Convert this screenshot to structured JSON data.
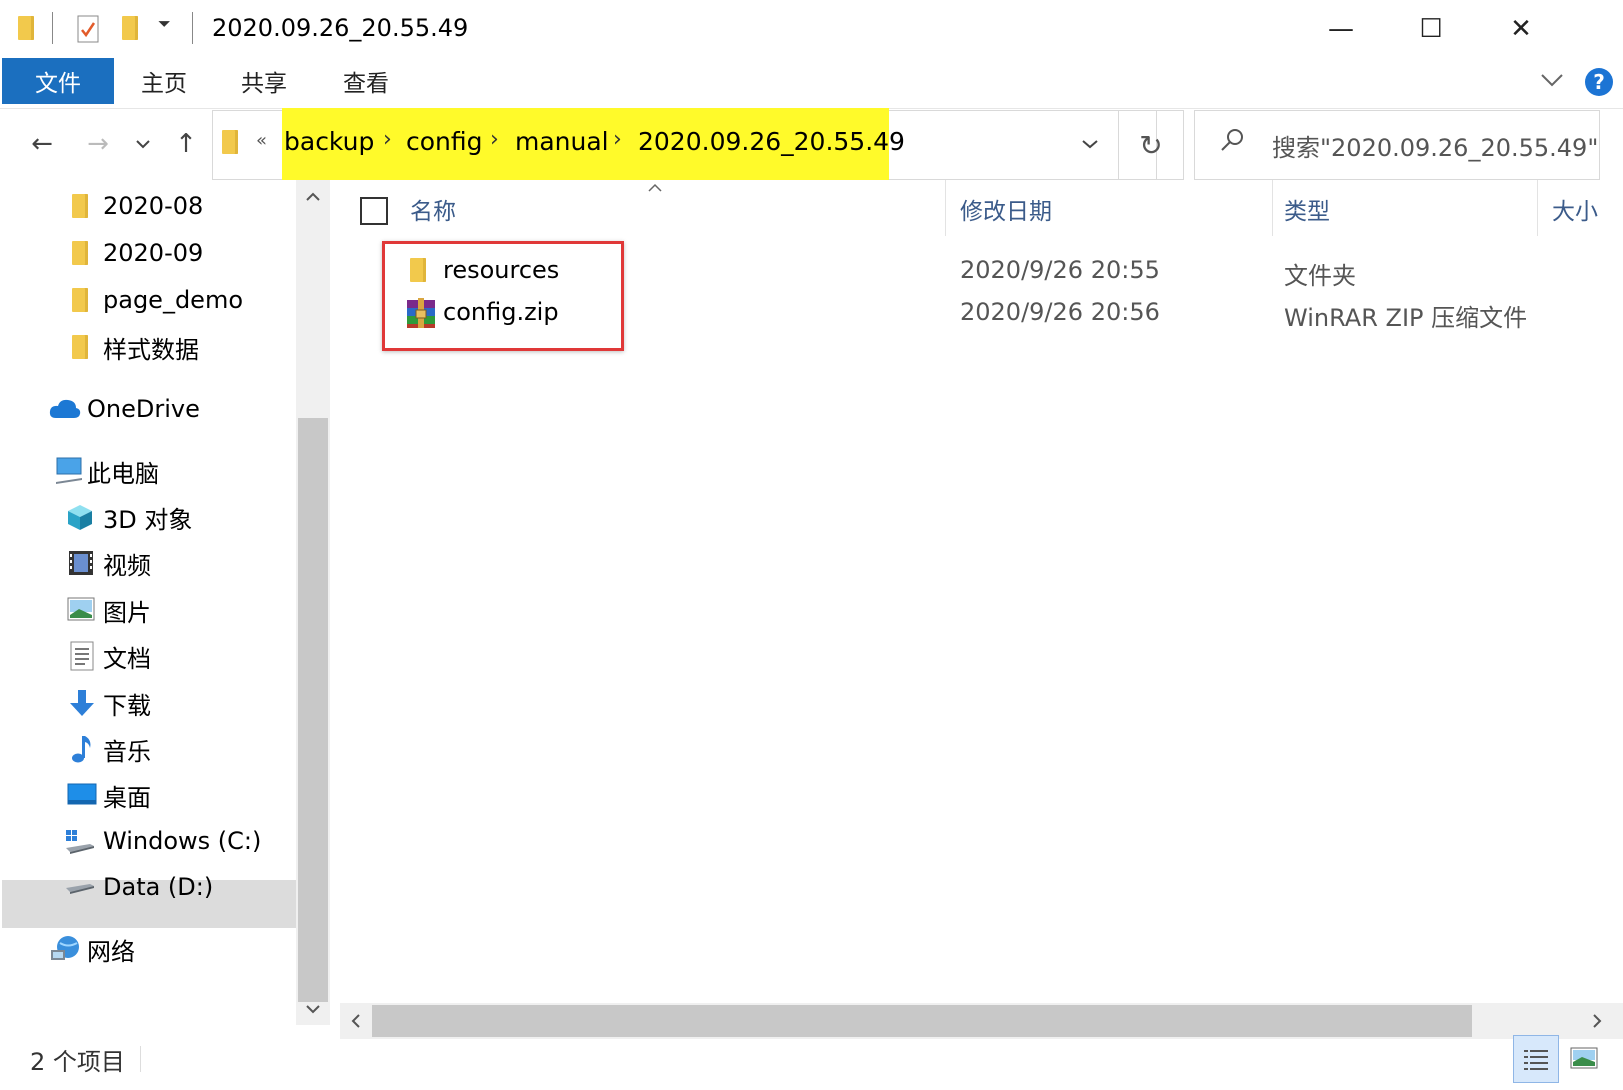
{
  "window": {
    "title": "2020.09.26_20.55.49",
    "minimize": "—",
    "maximize": "☐",
    "close": "✕"
  },
  "ribbon": {
    "tabs": [
      "文件",
      "主页",
      "共享",
      "查看"
    ],
    "help": "?"
  },
  "nav": {
    "back": "←",
    "forward": "→",
    "recent": "⌄",
    "up": "↑",
    "overflow": "«",
    "breadcrumbs": [
      "backup",
      "config",
      "manual",
      "2020.09.26_20.55.49"
    ],
    "separator": "›",
    "refresh": "↻",
    "dropdown": "⌄"
  },
  "search": {
    "placeholder": "搜索\"2020.09.26_20.55.49\""
  },
  "sidebar": {
    "items": [
      {
        "label": "2020-08",
        "icon": "folder-icon"
      },
      {
        "label": "2020-09",
        "icon": "folder-icon"
      },
      {
        "label": "page_demo",
        "icon": "folder-icon"
      },
      {
        "label": "样式数据",
        "icon": "folder-icon"
      },
      {
        "label": "OneDrive",
        "icon": "cloud-icon"
      },
      {
        "label": "此电脑",
        "icon": "computer-icon"
      },
      {
        "label": "3D 对象",
        "icon": "cube-icon"
      },
      {
        "label": "视频",
        "icon": "video-icon"
      },
      {
        "label": "图片",
        "icon": "picture-icon"
      },
      {
        "label": "文档",
        "icon": "document-icon"
      },
      {
        "label": "下载",
        "icon": "download-icon"
      },
      {
        "label": "音乐",
        "icon": "music-icon"
      },
      {
        "label": "桌面",
        "icon": "desktop-icon"
      },
      {
        "label": "Windows (C:)",
        "icon": "drive-c-icon"
      },
      {
        "label": "Data (D:)",
        "icon": "drive-d-icon"
      },
      {
        "label": "网络",
        "icon": "network-icon"
      }
    ],
    "selected": "Data (D:)"
  },
  "filelist": {
    "columns": [
      "名称",
      "修改日期",
      "类型",
      "大小"
    ],
    "rows": [
      {
        "name": "resources",
        "modified": "2020/9/26 20:55",
        "type": "文件夹",
        "size": "",
        "icon": "folder-icon"
      },
      {
        "name": "config.zip",
        "modified": "2020/9/26 20:56",
        "type": "WinRAR ZIP 压缩文件",
        "size": "",
        "icon": "winrar-icon"
      }
    ]
  },
  "status": {
    "item_count": "2 个项目"
  },
  "colors": {
    "accent": "#1b6fbf",
    "address_highlight": "#fffa2a",
    "annotation_box": "#e03838"
  }
}
